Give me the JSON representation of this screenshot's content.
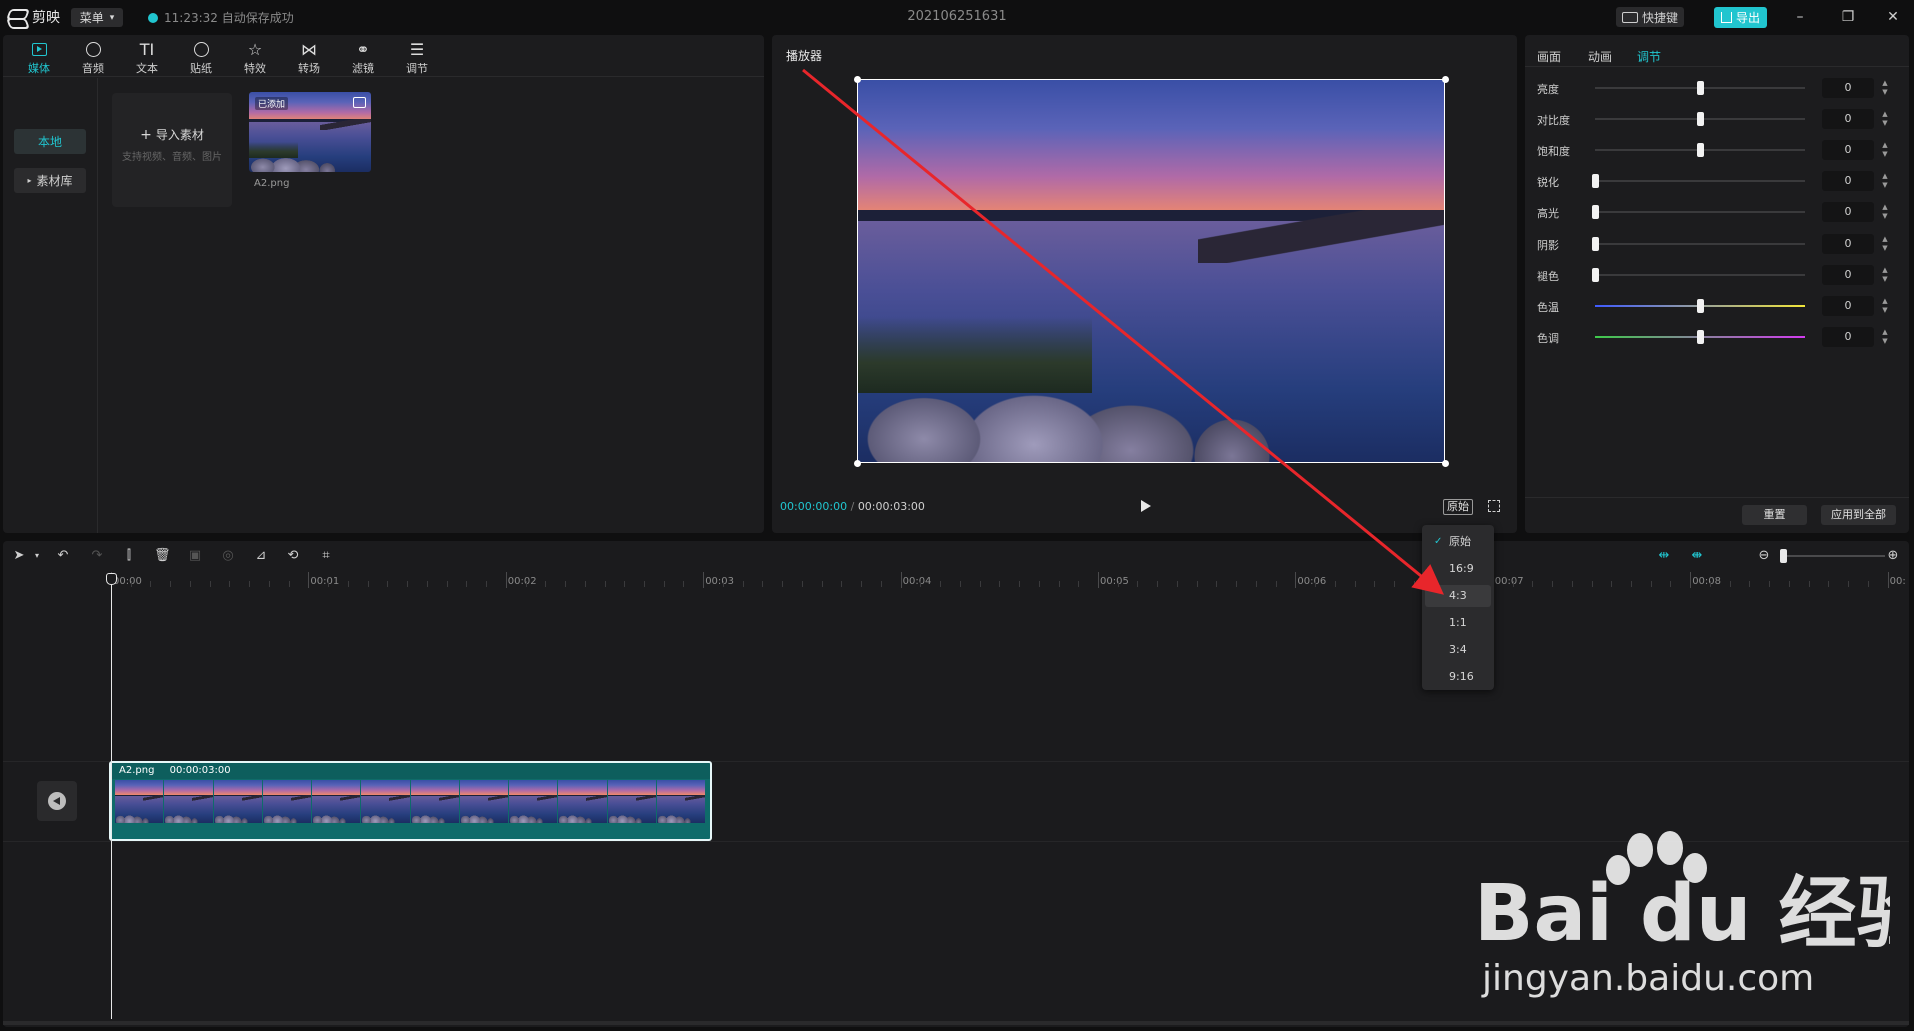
{
  "app": {
    "name": "剪映",
    "menu_label": "菜单",
    "save_status": "11:23:32 自动保存成功",
    "project_title": "202106251631",
    "shortcut_label": "快捷键",
    "export_label": "导出"
  },
  "media_tabs": [
    {
      "label": "媒体",
      "icon": "media-icon",
      "active": true
    },
    {
      "label": "音频",
      "icon": "audio-icon"
    },
    {
      "label": "文本",
      "icon": "text-icon",
      "glyph": "TI"
    },
    {
      "label": "贴纸",
      "icon": "sticker-icon"
    },
    {
      "label": "特效",
      "icon": "effects-icon"
    },
    {
      "label": "转场",
      "icon": "transition-icon"
    },
    {
      "label": "滤镜",
      "icon": "filter-icon"
    },
    {
      "label": "调节",
      "icon": "adjust-icon"
    }
  ],
  "media_side": {
    "local": "本地",
    "library": "素材库"
  },
  "import_card": {
    "title": "导入素材",
    "hint": "支持视频、音频、图片"
  },
  "asset": {
    "name": "A2.png",
    "tag": "已添加"
  },
  "player": {
    "title": "播放器",
    "current_time": "00:00:00:00",
    "total_time": "00:00:03:00",
    "ratio_label": "原始"
  },
  "adjust": {
    "tabs": [
      "画面",
      "动画",
      "调节"
    ],
    "active_tab": 2,
    "rows": [
      {
        "label": "亮度",
        "value": "0",
        "level": 0.5
      },
      {
        "label": "对比度",
        "value": "0",
        "level": 0.5
      },
      {
        "label": "饱和度",
        "value": "0",
        "level": 0.5
      },
      {
        "label": "锐化",
        "value": "0",
        "level": 0.0
      },
      {
        "label": "高光",
        "value": "0",
        "level": 0.0
      },
      {
        "label": "阴影",
        "value": "0",
        "level": 0.0
      },
      {
        "label": "褪色",
        "value": "0",
        "level": 0.0
      },
      {
        "label": "色温",
        "value": "0",
        "level": 0.5,
        "gradient": "temp"
      },
      {
        "label": "色调",
        "value": "0",
        "level": 0.5,
        "gradient": "tint"
      }
    ],
    "reset_label": "重置",
    "apply_all_label": "应用到全部"
  },
  "ratio_menu": {
    "items": [
      "原始",
      "16:9",
      "4:3",
      "1:1",
      "3:4",
      "9:16"
    ],
    "selected": "原始",
    "hovered": "4:3"
  },
  "timeline": {
    "ruler": [
      "00:00",
      "00:01",
      "00:02",
      "00:03",
      "00:04",
      "00:05",
      "00:06",
      "00:07",
      "00:08",
      "00:"
    ],
    "clip": {
      "name": "A2.png",
      "duration": "00:00:03:00"
    }
  },
  "watermark": {
    "brand": "Bai du 经验",
    "url": "jingyan.baidu.com"
  },
  "colors": {
    "accent": "#21c5cf",
    "annotation_arrow": "#e8262b"
  }
}
